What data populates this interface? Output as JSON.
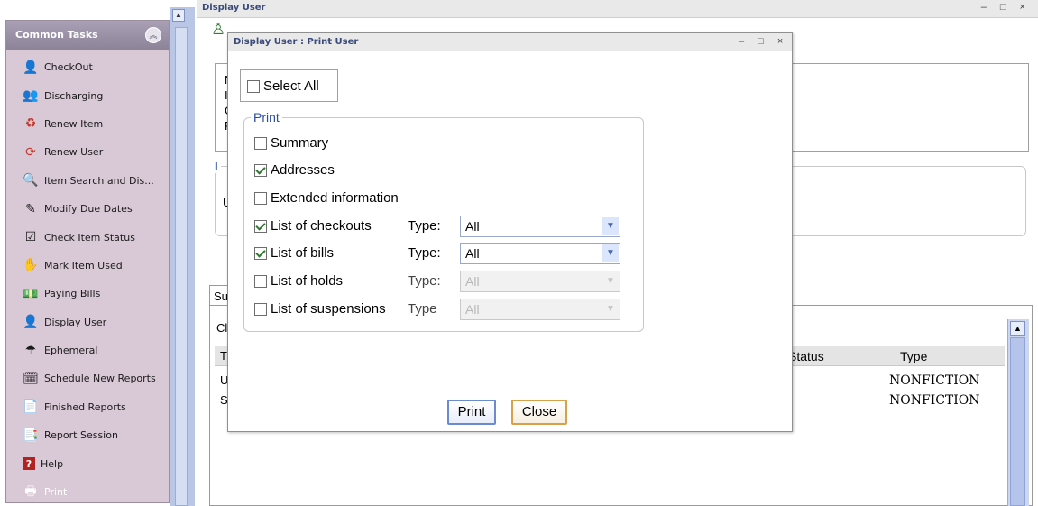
{
  "task_panel": {
    "title": "Common Tasks",
    "items": [
      {
        "label": "CheckOut",
        "icon": "user-checkout-icon",
        "glyph": "👤"
      },
      {
        "label": "Discharging",
        "icon": "users-discharge-icon",
        "glyph": "👥"
      },
      {
        "label": "Renew Item",
        "icon": "renew-item-icon",
        "glyph": "♻"
      },
      {
        "label": "Renew User",
        "icon": "renew-user-icon",
        "glyph": "⟳"
      },
      {
        "label": "Item Search and Dis...",
        "icon": "item-search-icon",
        "glyph": "🔍"
      },
      {
        "label": "Modify Due Dates",
        "icon": "modify-dates-icon",
        "glyph": "✎"
      },
      {
        "label": "Check Item Status",
        "icon": "check-status-icon",
        "glyph": "☑"
      },
      {
        "label": "Mark Item Used",
        "icon": "mark-used-icon",
        "glyph": "✋"
      },
      {
        "label": "Paying Bills",
        "icon": "paying-bills-icon",
        "glyph": "💵"
      },
      {
        "label": "Display User",
        "icon": "display-user-icon",
        "glyph": "👤"
      },
      {
        "label": "Ephemeral",
        "icon": "ephemeral-icon",
        "glyph": "☂"
      },
      {
        "label": "Schedule New Reports",
        "icon": "schedule-reports-icon",
        "glyph": "🗓"
      },
      {
        "label": "Finished Reports",
        "icon": "finished-reports-icon",
        "glyph": "📄"
      },
      {
        "label": "Report Session",
        "icon": "report-session-icon",
        "glyph": "📑"
      },
      {
        "label": "Help",
        "icon": "help-icon",
        "glyph": "?"
      },
      {
        "label": "Print",
        "icon": "print-icon",
        "glyph": "🖶",
        "disabled": true
      }
    ]
  },
  "main_window": {
    "title": "Display User",
    "controls": "– □ ×",
    "info_lines": [
      "N",
      "Ic",
      "Gı",
      "Pr"
    ],
    "group_legend": "I",
    "group_line": "U",
    "tab_label": "Su",
    "content_label": "Cl",
    "table": {
      "col_first": "T",
      "col_status": "Status",
      "col_type": "Type",
      "rows": [
        {
          "first": "U",
          "type": "NONFICTION"
        },
        {
          "first": "Sa",
          "type": "NONFICTION"
        }
      ]
    }
  },
  "print_dialog": {
    "title": "Display User : Print User",
    "controls": "– □ ×",
    "select_all": {
      "label": "Select All",
      "checked": false
    },
    "print_group_label": "Print",
    "options": [
      {
        "label": "Summary",
        "checked": false
      },
      {
        "label": "Addresses",
        "checked": true
      },
      {
        "label": "Extended information",
        "checked": false
      },
      {
        "label": "List of checkouts",
        "checked": true,
        "type_label": "Type:",
        "type_value": "All",
        "enabled": true
      },
      {
        "label": "List of bills",
        "checked": true,
        "type_label": "Type:",
        "type_value": "All",
        "enabled": true
      },
      {
        "label": "List of holds",
        "checked": false,
        "type_label": "Type:",
        "type_value": "All",
        "enabled": false
      },
      {
        "label": "List of suspensions",
        "checked": false,
        "type_label": "Type",
        "type_value": "All",
        "enabled": false
      }
    ],
    "buttons": {
      "print": "Print",
      "close": "Close"
    }
  }
}
